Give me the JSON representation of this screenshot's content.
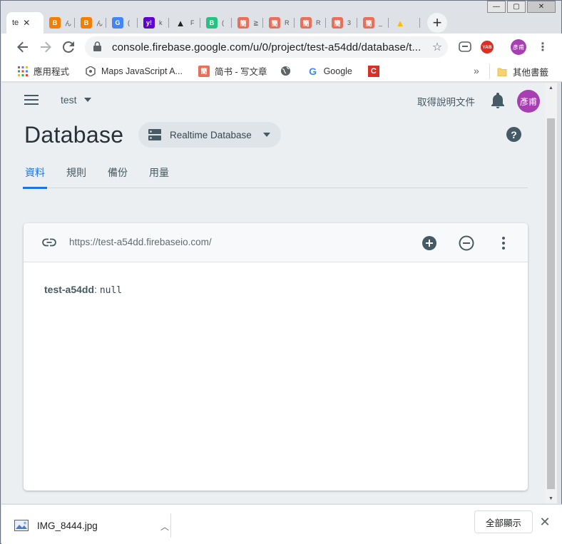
{
  "browser": {
    "active_tab_title": "te",
    "tabs": [
      {
        "favicon": "blogger-icon",
        "color": "#f57d00",
        "glyph": "B",
        "label": "ん"
      },
      {
        "favicon": "blogger-icon",
        "color": "#f57d00",
        "glyph": "B",
        "label": "ん"
      },
      {
        "favicon": "google-translate-icon",
        "color": "#4285f4",
        "glyph": "G",
        "label": "("
      },
      {
        "favicon": "yahoo-icon",
        "color": "#6001d2",
        "glyph": "y!",
        "label": "k"
      },
      {
        "favicon": "app-icon",
        "color": "#222222",
        "glyph": "▲",
        "label": "F"
      },
      {
        "favicon": "b-icon",
        "color": "#26c281",
        "glyph": "B",
        "label": "("
      },
      {
        "favicon": "jianshu-icon",
        "color": "#ea6f5a",
        "glyph": "簡",
        "label": "≧"
      },
      {
        "favicon": "jianshu-icon",
        "color": "#ea6f5a",
        "glyph": "簡",
        "label": "R"
      },
      {
        "favicon": "jianshu-icon",
        "color": "#ea6f5a",
        "glyph": "簡",
        "label": "R"
      },
      {
        "favicon": "jianshu-icon",
        "color": "#ea6f5a",
        "glyph": "簡",
        "label": "3"
      },
      {
        "favicon": "jianshu-icon",
        "color": "#ea6f5a",
        "glyph": "簡",
        "label": "_"
      },
      {
        "favicon": "google-drive-icon",
        "color": "#fbbc04",
        "glyph": "▲",
        "label": ""
      }
    ],
    "url": "console.firebase.google.com/u/0/project/test-a54dd/database/t...",
    "extensions": {
      "ext_yab": "YAB",
      "profile": "彥甫"
    },
    "bookmarks": [
      {
        "icon": "apps-icon",
        "label": "應用程式"
      },
      {
        "icon": "maps-icon",
        "label": "Maps JavaScript A..."
      },
      {
        "icon": "jianshu-icon",
        "label": "简书 - 写文章"
      },
      {
        "icon": "globe-icon",
        "label": ""
      },
      {
        "icon": "google-icon",
        "label": "Google"
      },
      {
        "icon": "c-icon",
        "label": ""
      }
    ],
    "more_bookmarks": "»",
    "other_bookmarks": "其他書籤"
  },
  "firebase": {
    "project_name": "test",
    "docs_link": "取得說明文件",
    "user_avatar": "彥甫",
    "page_title": "Database",
    "db_selector": "Realtime Database",
    "tabs": [
      "資料",
      "規則",
      "備份",
      "用量"
    ],
    "active_tab": 0,
    "db_url": "https://test-a54dd.firebaseio.com/",
    "data_key": "test-a54dd",
    "data_separator": ":",
    "data_value": "null"
  },
  "download_bar": {
    "file_name": "IMG_8444.jpg",
    "show_all": "全部顯示"
  },
  "colors": {
    "accent": "#1a73e8",
    "avatar": "#a73fb3",
    "page_bg": "#eceff1"
  }
}
